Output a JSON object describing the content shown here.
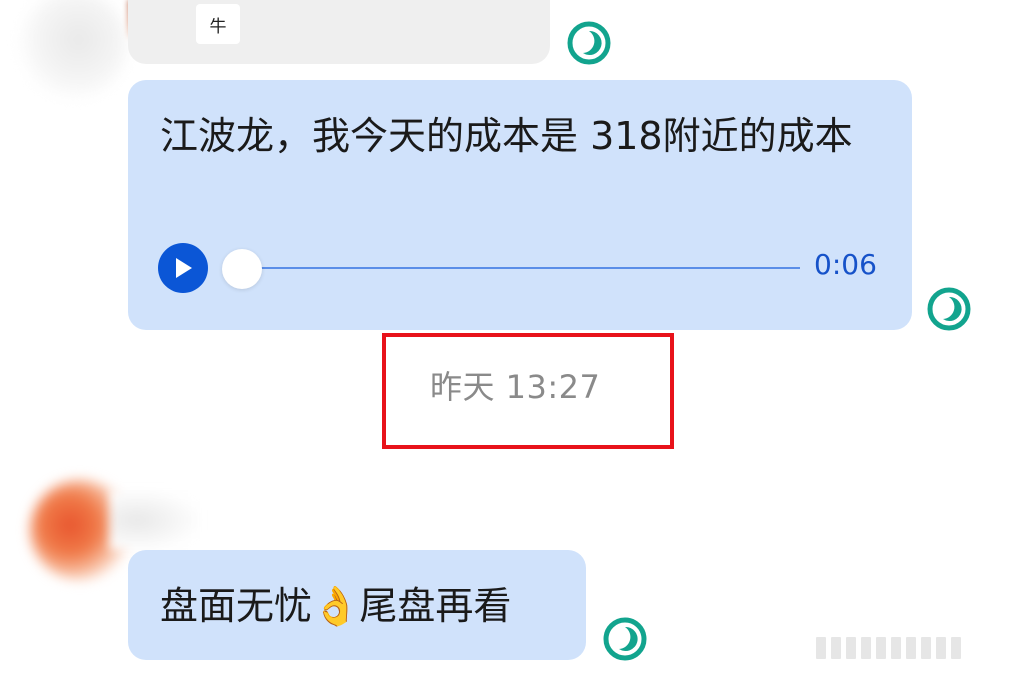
{
  "messages": {
    "top_chip": "牛",
    "voice": {
      "transcript": "江波龙，我今天的成本是 318附近的成本",
      "duration": "0:06",
      "progress": 0
    },
    "timestamp": "昨天 13:27",
    "short": {
      "before_emoji": "盘面无忧",
      "emoji": "👌",
      "after_emoji": "尾盘再看"
    }
  },
  "colors": {
    "bubble_blue": "#d0e2fb",
    "bubble_gray": "#efefef",
    "play_button": "#0b56d6",
    "status_icon": "#12a48e",
    "highlight_box": "#e8121a"
  },
  "icons": {
    "play": "play-icon",
    "status": "read-status-icon"
  }
}
